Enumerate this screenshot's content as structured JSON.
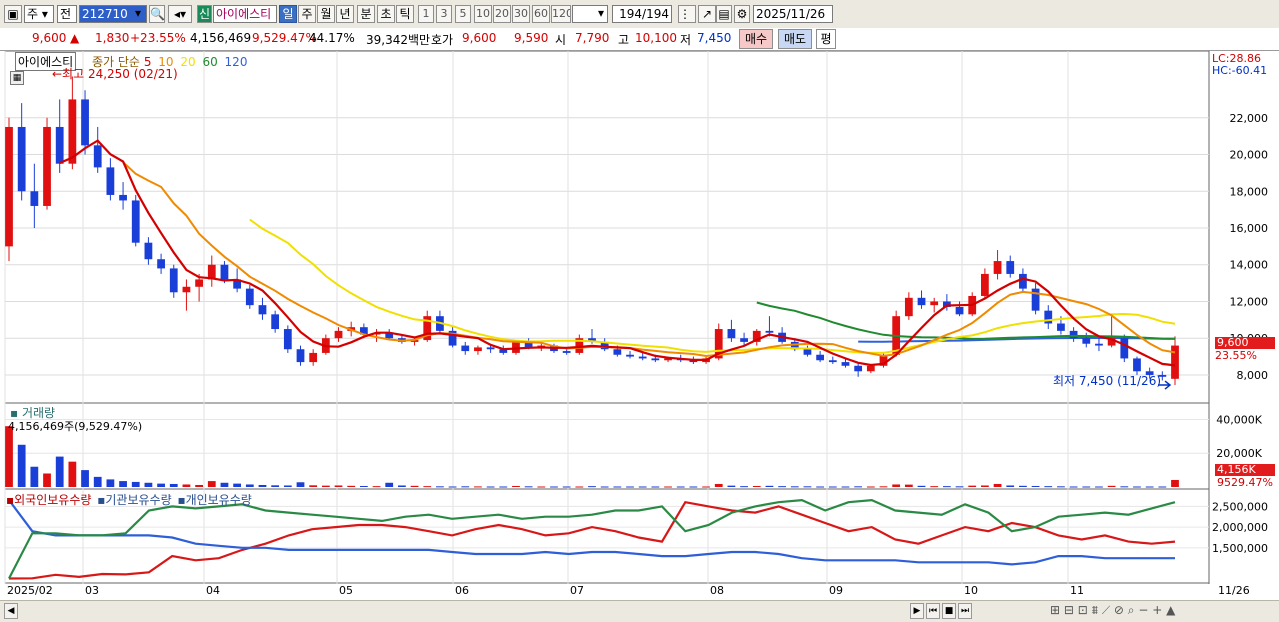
{
  "toolbar": {
    "period": "주",
    "prev": "전",
    "code": "212710",
    "new_badge": "신",
    "stock_name": "아이에스티",
    "tf": [
      "일",
      "주",
      "월",
      "년",
      "분",
      "초",
      "틱"
    ],
    "tf_selected": "일",
    "nums": [
      "1",
      "3",
      "5",
      "10",
      "20",
      "30",
      "60",
      "120"
    ],
    "count": "194",
    "total": "/194",
    "date": "2025/11/26"
  },
  "quote": {
    "price": "9,600",
    "arrow": "▲",
    "change": "1,830",
    "change_pct": "+23.55%",
    "volume": "4,156,469",
    "volume_pct": "9,529.47%",
    "turnover": "44.17%",
    "amount": "39,342백만",
    "hoga_label": "호가",
    "hoga_ask": "9,600",
    "hoga_bid": "9,590",
    "open_label": "시",
    "open": "7,790",
    "high_label": "고",
    "high": "10,100",
    "low_label": "저",
    "low": "7,450",
    "buy": "매수",
    "sell": "매도",
    "eval": "평"
  },
  "price_panel": {
    "name_box": "아이에스티",
    "legend_prefix": "종가 단순",
    "ma_labels": [
      "5",
      "10",
      "20",
      "60",
      "120"
    ],
    "ma_colors": [
      "#d40000",
      "#f08a00",
      "#f0e000",
      "#208a30",
      "#3060e0"
    ],
    "high_note": "←최고 24,250 (02/21)",
    "low_note": "최저 7,450 (11/26)",
    "lc": "LC:28.86",
    "hc": "HC:-60.41",
    "last_price_tag": "9,600",
    "last_pct_tag": "23.55%"
  },
  "volume_panel": {
    "title": "거래량",
    "value_label": "4,156,469주(9,529.47%)",
    "tag_value": "4,156K",
    "tag_pct": "9529.47%"
  },
  "holdings_panel": {
    "labels": [
      "외국인보유수량",
      "기관보유수량",
      "개인보유수량"
    ],
    "colors": [
      "#d40000",
      "#3060e0",
      "#208a30"
    ]
  },
  "x_axis": [
    "2025/02",
    "03",
    "04",
    "05",
    "06",
    "07",
    "08",
    "09",
    "10",
    "11"
  ],
  "x_right": "11/26",
  "chart_data": [
    {
      "type": "line",
      "title": "아이에스티 일봉",
      "ylabel": "",
      "y_ticks": [
        "22,000",
        "20,000",
        "18,000",
        "16,000",
        "14,000",
        "12,000",
        "10,000",
        "8,000"
      ],
      "ylim": [
        6800,
        25200
      ],
      "candles": [
        [
          15000,
          22000,
          14200,
          21500
        ],
        [
          21500,
          22800,
          17500,
          18000
        ],
        [
          18000,
          19500,
          16000,
          17200
        ],
        [
          17200,
          22000,
          17000,
          21500
        ],
        [
          21500,
          23000,
          19000,
          19500
        ],
        [
          19500,
          24250,
          19200,
          23000
        ],
        [
          23000,
          23500,
          20000,
          20500
        ],
        [
          20500,
          21500,
          19000,
          19300
        ],
        [
          19300,
          19800,
          17500,
          17800
        ],
        [
          17800,
          18500,
          17000,
          17500
        ],
        [
          17500,
          17800,
          15000,
          15200
        ],
        [
          15200,
          15500,
          14000,
          14300
        ],
        [
          14300,
          14600,
          13500,
          13800
        ],
        [
          13800,
          14000,
          12200,
          12500
        ],
        [
          12500,
          13200,
          11500,
          12800
        ],
        [
          12800,
          13500,
          12000,
          13200
        ],
        [
          13200,
          14500,
          12800,
          14000
        ],
        [
          14000,
          14200,
          13000,
          13200
        ],
        [
          13200,
          13800,
          12500,
          12700
        ],
        [
          12700,
          12900,
          11600,
          11800
        ],
        [
          11800,
          12200,
          11000,
          11300
        ],
        [
          11300,
          11500,
          10300,
          10500
        ],
        [
          10500,
          10700,
          9200,
          9400
        ],
        [
          9400,
          9600,
          8500,
          8700
        ],
        [
          8700,
          9400,
          8500,
          9200
        ],
        [
          9200,
          10200,
          9100,
          10000
        ],
        [
          10000,
          10600,
          9800,
          10400
        ],
        [
          10400,
          10900,
          10100,
          10600
        ],
        [
          10600,
          10800,
          10000,
          10200
        ],
        [
          10200,
          10500,
          9800,
          10300
        ],
        [
          10300,
          10500,
          9900,
          10000
        ],
        [
          10000,
          10200,
          9700,
          9800
        ],
        [
          9800,
          10100,
          9600,
          9900
        ],
        [
          9900,
          11500,
          9800,
          11200
        ],
        [
          11200,
          11500,
          10200,
          10400
        ],
        [
          10400,
          10600,
          9500,
          9600
        ],
        [
          9600,
          9800,
          9100,
          9300
        ],
        [
          9300,
          9600,
          9100,
          9500
        ],
        [
          9500,
          9700,
          9200,
          9400
        ],
        [
          9400,
          9600,
          9100,
          9200
        ],
        [
          9200,
          9900,
          9100,
          9800
        ],
        [
          9800,
          10000,
          9400,
          9500
        ],
        [
          9500,
          9800,
          9300,
          9600
        ],
        [
          9600,
          9700,
          9200,
          9300
        ],
        [
          9300,
          9500,
          9100,
          9200
        ],
        [
          9200,
          10200,
          9100,
          10000
        ],
        [
          10000,
          10500,
          9700,
          9800
        ],
        [
          9800,
          10000,
          9300,
          9400
        ],
        [
          9400,
          9600,
          9000,
          9100
        ],
        [
          9100,
          9300,
          8900,
          9000
        ],
        [
          9000,
          9200,
          8800,
          8900
        ],
        [
          8900,
          9100,
          8700,
          8800
        ],
        [
          8800,
          9000,
          8700,
          8900
        ],
        [
          8900,
          9100,
          8700,
          8800
        ],
        [
          8800,
          9000,
          8600,
          8700
        ],
        [
          8700,
          9000,
          8600,
          8900
        ],
        [
          8900,
          10800,
          8800,
          10500
        ],
        [
          10500,
          11000,
          9800,
          10000
        ],
        [
          10000,
          10300,
          9600,
          9800
        ],
        [
          9800,
          10500,
          9600,
          10400
        ],
        [
          10400,
          11200,
          10100,
          10300
        ],
        [
          10300,
          10600,
          9700,
          9800
        ],
        [
          9800,
          10000,
          9300,
          9400
        ],
        [
          9400,
          9600,
          9000,
          9100
        ],
        [
          9100,
          9300,
          8700,
          8800
        ],
        [
          8800,
          9000,
          8600,
          8700
        ],
        [
          8700,
          8900,
          8400,
          8500
        ],
        [
          8500,
          8700,
          7900,
          8200
        ],
        [
          8200,
          8600,
          8100,
          8500
        ],
        [
          8500,
          9200,
          8400,
          9100
        ],
        [
          9100,
          11500,
          9000,
          11200
        ],
        [
          11200,
          12500,
          11000,
          12200
        ],
        [
          12200,
          12600,
          11600,
          11800
        ],
        [
          11800,
          12200,
          11400,
          12000
        ],
        [
          12000,
          12400,
          11500,
          11700
        ],
        [
          11700,
          12000,
          11200,
          11300
        ],
        [
          11300,
          12500,
          11200,
          12300
        ],
        [
          12300,
          13800,
          12100,
          13500
        ],
        [
          13500,
          14800,
          13200,
          14200
        ],
        [
          14200,
          14500,
          13300,
          13500
        ],
        [
          13500,
          13800,
          12500,
          12700
        ],
        [
          12700,
          13000,
          11300,
          11500
        ],
        [
          11500,
          11800,
          10500,
          10800
        ],
        [
          10800,
          11200,
          10200,
          10400
        ],
        [
          10400,
          10600,
          9800,
          10000
        ],
        [
          10000,
          10300,
          9500,
          9700
        ],
        [
          9700,
          10000,
          9300,
          9600
        ],
        [
          9600,
          11200,
          9500,
          10000
        ],
        [
          10000,
          10200,
          8700,
          8900
        ],
        [
          8900,
          9000,
          8000,
          8200
        ],
        [
          8200,
          8400,
          7800,
          8000
        ],
        [
          8000,
          8200,
          7700,
          7900
        ],
        [
          7790,
          10100,
          7450,
          9600
        ]
      ],
      "holdings": {
        "foreign": [
          760,
          765,
          850,
          800,
          870,
          860,
          910,
          1300,
          1200,
          1250,
          1450,
          1600,
          1800,
          1950,
          2000,
          2050,
          2050,
          2000,
          1900,
          1800,
          1950,
          2050,
          1950,
          1800,
          1850,
          2000,
          1900,
          1750,
          1650,
          2600,
          2500,
          2400,
          2350,
          2500,
          2300,
          2100,
          1900,
          2000,
          1700,
          1600,
          1800,
          2000,
          1900,
          2100,
          2000,
          1800,
          1700,
          1800,
          1650,
          1600,
          1650
        ],
        "institution": [
          2650,
          1900,
          1800,
          1800,
          1800,
          1800,
          1800,
          1750,
          1600,
          1550,
          1500,
          1500,
          1450,
          1450,
          1450,
          1450,
          1450,
          1450,
          1450,
          1400,
          1350,
          1350,
          1350,
          1400,
          1350,
          1400,
          1400,
          1350,
          1300,
          1300,
          1350,
          1400,
          1400,
          1350,
          1250,
          1200,
          1200,
          1200,
          1200,
          1150,
          1150,
          1150,
          1150,
          1100,
          1150,
          1300,
          1300,
          1250,
          1250,
          1250,
          1250
        ],
        "individual": [
          760,
          1850,
          1850,
          1800,
          1800,
          1850,
          2400,
          2500,
          2450,
          2500,
          2550,
          2400,
          2350,
          2300,
          2250,
          2200,
          2150,
          2250,
          2300,
          2200,
          2250,
          2300,
          2200,
          2250,
          2250,
          2300,
          2400,
          2400,
          2500,
          1900,
          2050,
          2350,
          2500,
          2600,
          2650,
          2400,
          2600,
          2650,
          2400,
          2350,
          2300,
          2550,
          2350,
          1900,
          2000,
          2250,
          2300,
          2350,
          2300,
          2450,
          2600
        ]
      },
      "holdings_ticks": [
        "2,500,000",
        "2,000,000",
        "1,500,000"
      ],
      "volume_ticks": [
        "40,000K",
        "20,000K"
      ],
      "volume": [
        36000,
        25000,
        12000,
        8000,
        18000,
        15000,
        10000,
        6000,
        4500,
        3500,
        3000,
        2500,
        2000,
        1800,
        1500,
        1200,
        3500,
        2500,
        2000,
        1500,
        1200,
        1000,
        900,
        2800,
        1000,
        800,
        900,
        700,
        600,
        500,
        2500,
        900,
        700,
        500,
        400,
        300,
        400,
        350,
        300,
        300,
        600,
        400,
        300,
        300,
        300,
        300,
        500,
        300,
        300,
        300,
        300,
        300,
        300,
        300,
        300,
        300,
        1800,
        800,
        500,
        600,
        700,
        500,
        400,
        400,
        300,
        300,
        300,
        400,
        300,
        400,
        1500,
        1400,
        700,
        500,
        500,
        400,
        800,
        900,
        1800,
        900,
        700,
        600,
        500,
        400,
        300,
        300,
        300,
        700,
        400,
        300,
        300,
        300,
        4156
      ]
    }
  ]
}
